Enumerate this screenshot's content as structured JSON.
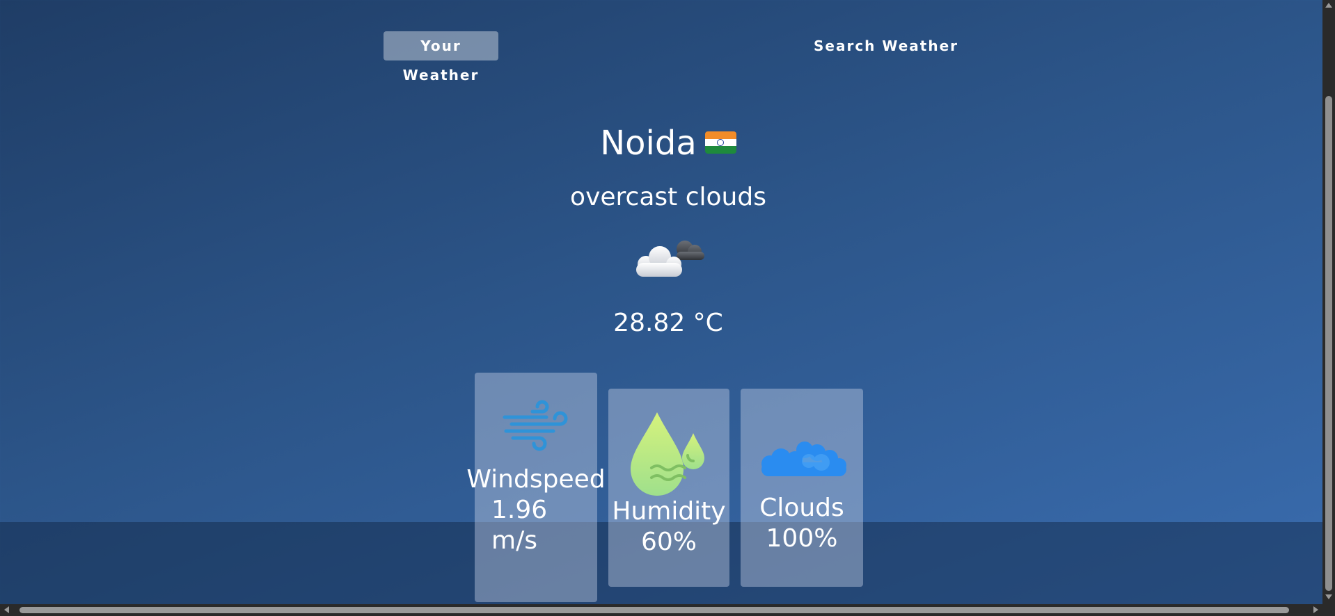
{
  "tabs": {
    "your_weather": "Your Weather",
    "search_weather": "Search Weather"
  },
  "location": {
    "city": "Noida",
    "flag_icon": "india-flag-icon"
  },
  "conditions": {
    "description": "overcast clouds",
    "icon": "cloud-icon",
    "temperature": "28.82 °C"
  },
  "stats": {
    "windspeed": {
      "label": "Windspeed",
      "value_line1": "1.96",
      "value_line2": "m/s",
      "icon": "wind-icon"
    },
    "humidity": {
      "label": "Humidity",
      "value": "60%",
      "icon": "humidity-icon"
    },
    "clouds": {
      "label": "Clouds",
      "value": "100%",
      "icon": "clouds-icon"
    }
  },
  "colors": {
    "background": "#2c5589",
    "tab_active": "rgba(255,255,255,0.38)",
    "wind_icon": "#2f93d8",
    "humidity_icon": "#c6ef7a",
    "clouds_icon": "#2a8cf0"
  }
}
